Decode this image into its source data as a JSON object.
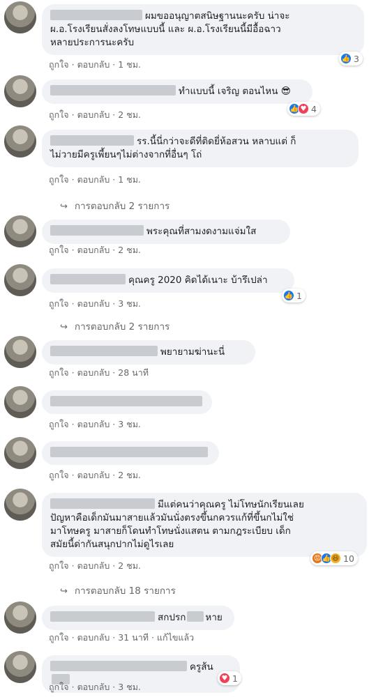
{
  "comments": [
    {
      "lines": [
        "ผมขออนุญาตสนิษฐานนะครับ น่าจะ",
        "ผ.อ.โรงเรียนสั่งลงโทษแบบนี้ และ ผ.อ.โรงเรียนนี้มีอื้อฉาว",
        "หลายประการนะครับ"
      ],
      "time": "1 ชม.",
      "reaction_count": "3",
      "reactions": [
        "like-icon"
      ]
    },
    {
      "lines": [
        "ทำแบบนี้ เจริญ ตอนไหน 😎"
      ],
      "time": "2 ชม.",
      "reaction_count": "4",
      "reactions": [
        "like-icon",
        "love-icon"
      ]
    },
    {
      "lines": [
        "รร.นี้นี่กว่าจะดีที่ติดยี่ห้อสวน หลาบแต่ ก็",
        "ไม่วายมีครูเพี้ยนๆไม่ต่างจากที่อื่นๆ โถ่"
      ],
      "time": "1 ชม.",
      "replies": "การตอบกลับ 2 รายการ"
    },
    {
      "lines": [
        "พระคุณที่สามงดงามแจ่มใส"
      ],
      "time": "2 ชม."
    },
    {
      "lines": [
        "คุณครู 2020 คิดได้เนาะ บ้ารึเปล่า"
      ],
      "time": "3 ชม.",
      "reaction_count": "1",
      "reactions": [
        "like-icon"
      ],
      "replies": "การตอบกลับ 2 รายการ"
    },
    {
      "lines": [
        "พยายามฆ่านะนี่"
      ],
      "time": "28 นาที"
    },
    {
      "lines": [
        ""
      ],
      "time": "3 ชม."
    },
    {
      "lines": [
        ""
      ],
      "time": "2 ชม."
    },
    {
      "lines": [
        "มีแต่คนว่าคุณครู ไม่โทษนักเรียนเลย",
        "ปัญหาคือเด็กมันมาสายแล้วมันนั่งตรงขึ้นกควรแก้ที่ขึ้นกไม่ใช่",
        "มาโทษครู มาสายก็โดนทำโทษนั่งแสตน ตามกฎระเบียบ เด็ก",
        "สมัยนี้ด่ากันสนุกปากไม่ดูไรเลย"
      ],
      "time": "2 ชม.",
      "reaction_count": "10",
      "reactions": [
        "angry-icon",
        "like-icon",
        "haha-icon"
      ],
      "replies": "การตอบกลับ 18 รายการ"
    },
    {
      "lines": [
        "สกปรก",
        "หาย"
      ],
      "time": "31 นาที",
      "edited": "แก้ไขแล้ว"
    },
    {
      "lines": [
        "ครูส้น"
      ],
      "time": "3 ชม.",
      "reaction_count": "1",
      "reactions": [
        "love-icon"
      ]
    }
  ],
  "labels": {
    "like": "ถูกใจ",
    "reply": "ตอบกลับ",
    "separator": "·"
  },
  "icons": {
    "replies_arrow": "reply-arrow-icon"
  },
  "colors": {
    "bubble": "#f0f2f5",
    "meta": "#65676b",
    "like": "#1877f2",
    "love": "#f33e58"
  }
}
